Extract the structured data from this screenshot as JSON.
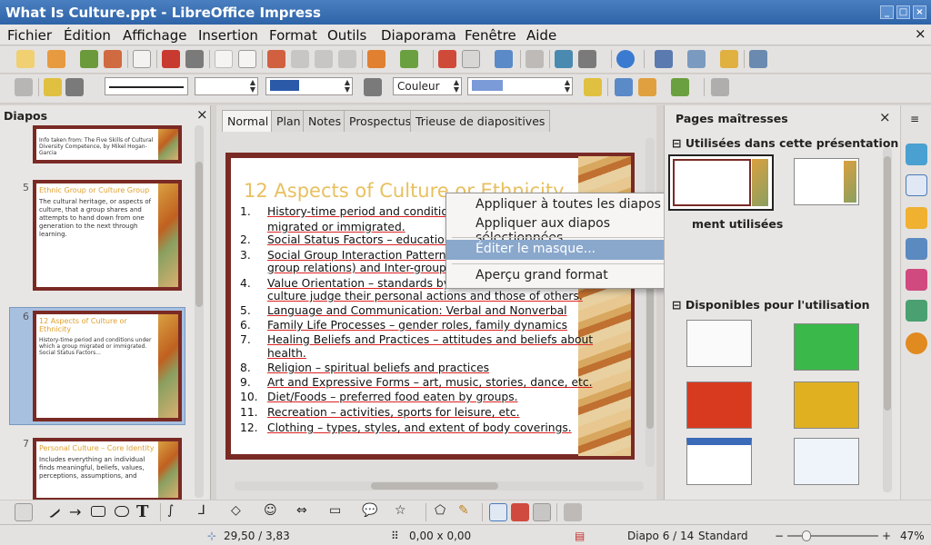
{
  "window": {
    "title": "What Is Culture.ppt - LibreOffice Impress"
  },
  "menu": [
    "Fichier",
    "Édition",
    "Affichage",
    "Insertion",
    "Format",
    "Outils",
    "Diaporama",
    "Fenêtre",
    "Aide"
  ],
  "toolbar2": {
    "color_label": "Couleur"
  },
  "slides_panel": {
    "title": "Diapos",
    "thumbs": [
      {
        "num": "5",
        "title": "Ethnic Group or Culture Group",
        "body": "The cultural heritage, or aspects of culture, that a group shares and attempts to hand down from one generation to the next through learning."
      },
      {
        "num": "6",
        "title": "12 Aspects of Culture or Ethnicity",
        "body": "History-time period and conditions under which a group migrated or immigrated. Social Status Factors..."
      },
      {
        "num": "7",
        "title": "Personal Culture – Core Identity",
        "body": "Includes everything an individual finds meaningful, beliefs, values, perceptions, assumptions, and"
      }
    ],
    "top_caption": "Info taken from: The Five Skills of Cultural Diversity Competence, by Mikel Hogan-Garcia"
  },
  "tabs": [
    "Normal",
    "Plan",
    "Notes",
    "Prospectus",
    "Trieuse de diapositives"
  ],
  "slide": {
    "title": "12 Aspects of Culture or Ethnicity",
    "items": [
      {
        "n": "1.",
        "text": "History-time period and conditions u"
      },
      {
        "n": "",
        "text": "migrated or immigrated."
      },
      {
        "n": "2.",
        "text": "Social Status Factors – education, o"
      },
      {
        "n": "3.",
        "text": "Social Group Interaction Patterns: I"
      },
      {
        "n": "",
        "text": "group relations) and Inter-group (be"
      },
      {
        "n": "4.",
        "text": "Value Orientation – standards by w"
      },
      {
        "n": "",
        "text": "culture judge their personal actions and those of others."
      },
      {
        "n": "5.",
        "text": "Language and Communication: Verbal and Nonverbal"
      },
      {
        "n": "6.",
        "text": "Family Life Processes – gender roles, family dynamics"
      },
      {
        "n": "7.",
        "text": "Healing Beliefs and Practices – attitudes and beliefs about"
      },
      {
        "n": "",
        "text": "health."
      },
      {
        "n": "8.",
        "text": "Religion – spiritual beliefs and practices"
      },
      {
        "n": "9.",
        "text": "Art and Expressive Forms – art, music, stories, dance, etc."
      },
      {
        "n": "10.",
        "text": "Diet/Foods – preferred food eaten by groups."
      },
      {
        "n": "11.",
        "text": "Recreation – activities, sports for leisure, etc."
      },
      {
        "n": "12.",
        "text": "Clothing – types, styles, and extent of body coverings."
      }
    ]
  },
  "context_menu": {
    "items": [
      "Appliquer à toutes les diapos",
      "Appliquer aux diapos sélectionnées",
      "Éditer le masque...",
      "Aperçu grand format"
    ]
  },
  "master_panel": {
    "title": "Pages maîtresses",
    "section_used": "Utilisées dans cette présentation",
    "section_recent": "ment utilisées",
    "section_available": "Disponibles pour l'utilisation"
  },
  "status": {
    "position": "29,50 / 3,83",
    "size": "0,00 x 0,00",
    "slide": "Diapo 6 / 14",
    "layout": "Standard",
    "zoom": "47%"
  }
}
